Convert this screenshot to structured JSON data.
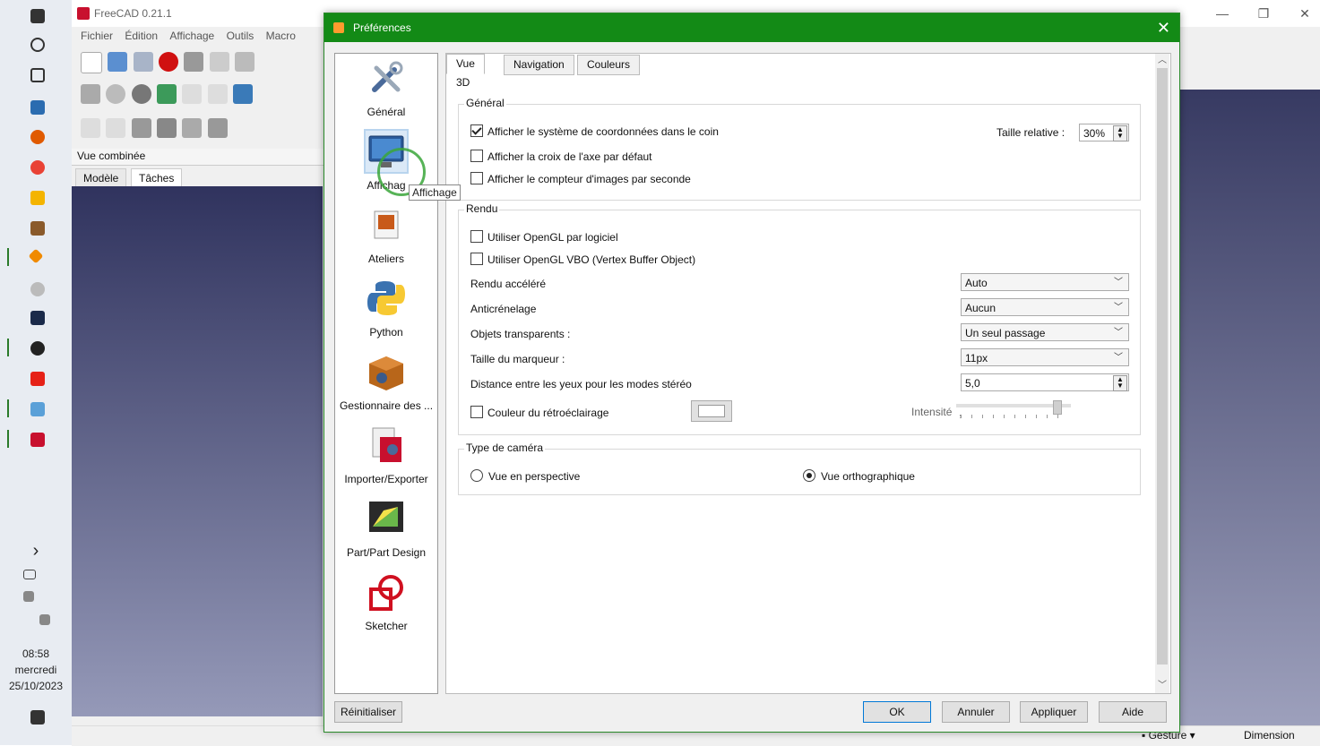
{
  "taskbar": {
    "time": "08:58",
    "day": "mercredi",
    "date": "25/10/2023",
    "expand_glyph": "›"
  },
  "freecad": {
    "title": "FreeCAD 0.21.1",
    "menus": [
      "Fichier",
      "Édition",
      "Affichage",
      "Outils",
      "Macro"
    ],
    "combo_view_title": "Vue combinée",
    "combo_tabs": [
      "Modèle",
      "Tâches"
    ],
    "status": {
      "gesture": "Gesture",
      "dimension": "Dimension"
    },
    "accent_red": "#c8102e"
  },
  "dialog": {
    "title": "Préférences",
    "title_bar_color": "#138a16",
    "pages": [
      {
        "label": "Général",
        "icon": "tools-icon"
      },
      {
        "label": "Affichag",
        "icon": "display-monitor-icon"
      },
      {
        "label": "Ateliers",
        "icon": "workbench-icon"
      },
      {
        "label": "Python",
        "icon": "python-icon"
      },
      {
        "label": "Gestionnaire des ...",
        "icon": "addon-manager-icon"
      },
      {
        "label": "Importer/Exporter",
        "icon": "import-export-icon"
      },
      {
        "label": "Part/Part Design",
        "icon": "part-design-icon"
      },
      {
        "label": "Sketcher",
        "icon": "sketcher-icon"
      }
    ],
    "tooltip": "Affichage",
    "tabs": [
      "Vue 3D",
      "Navigation",
      "Couleurs"
    ],
    "general": {
      "title": "Général",
      "show_coords": "Afficher le système de coordonnées dans le coin",
      "show_coords_checked": true,
      "relative_size_label": "Taille relative :",
      "relative_size_value": "30%",
      "show_axis_cross": "Afficher la croix de l'axe par défaut",
      "show_fps": "Afficher le compteur d'images par seconde"
    },
    "render": {
      "title": "Rendu",
      "software_opengl": "Utiliser OpenGL par logiciel",
      "opengl_vbo": "Utiliser OpenGL VBO (Vertex Buffer Object)",
      "accelerated_label": "Rendu accéléré",
      "accelerated_value": "Auto",
      "antialias_label": "Anticrénelage",
      "antialias_value": "Aucun",
      "transparent_label": "Objets transparents :",
      "transparent_value": "Un seul passage",
      "marker_label": "Taille du marqueur :",
      "marker_value": "11px",
      "eye_distance_label": "Distance entre les yeux pour les modes stéréo",
      "eye_distance_value": "5,0",
      "backlight_label": "Couleur du rétroéclairage",
      "intensity_label": "Intensité",
      "intensity_level": 0.9
    },
    "camera": {
      "title": "Type de caméra",
      "perspective": "Vue en perspective",
      "orthographic": "Vue orthographique",
      "selected": "orthographic"
    },
    "buttons": {
      "reset": "Réinitialiser",
      "ok": "OK",
      "cancel": "Annuler",
      "apply": "Appliquer",
      "help": "Aide"
    }
  }
}
